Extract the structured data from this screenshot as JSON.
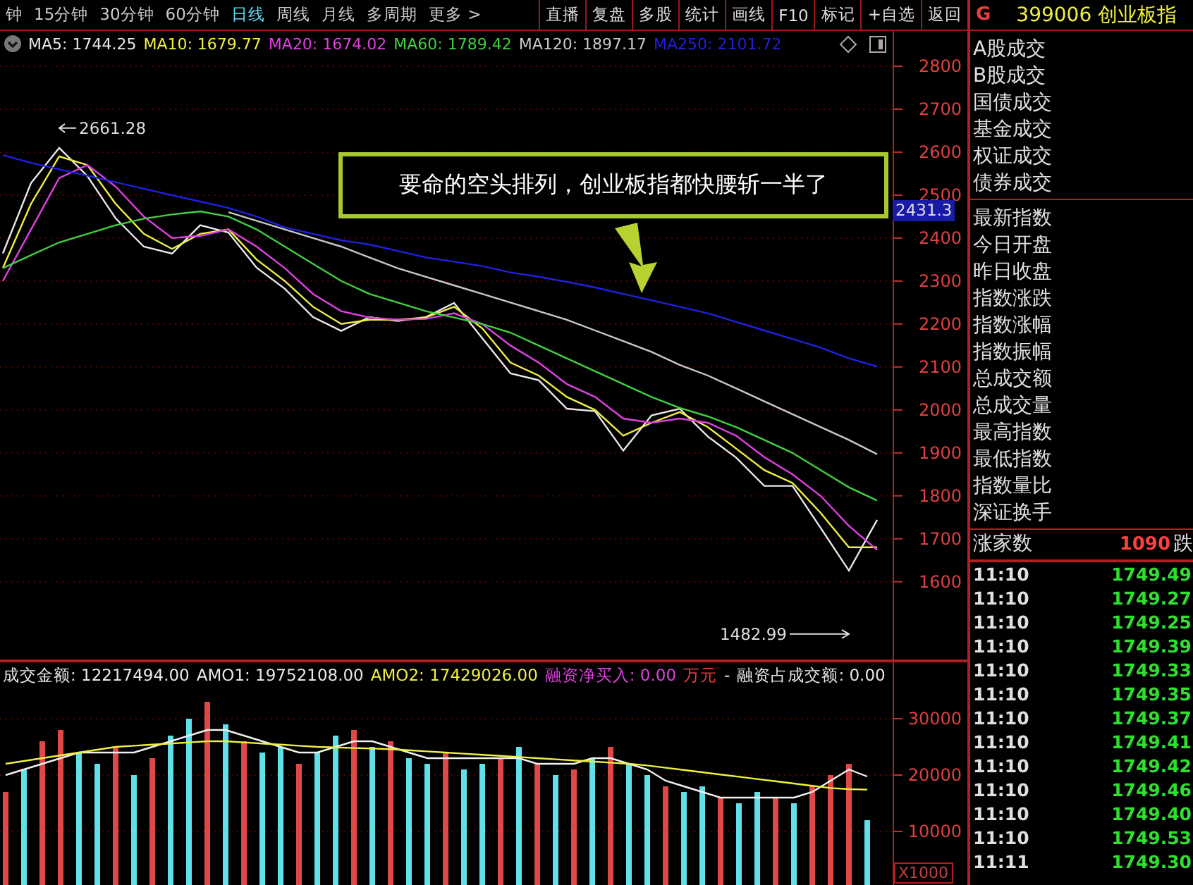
{
  "period_tabs": [
    {
      "label": "钟",
      "selected": false
    },
    {
      "label": "15分钟",
      "selected": false
    },
    {
      "label": "30分钟",
      "selected": false
    },
    {
      "label": "60分钟",
      "selected": false
    },
    {
      "label": "日线",
      "selected": true
    },
    {
      "label": "周线",
      "selected": false
    },
    {
      "label": "月线",
      "selected": false
    },
    {
      "label": "多周期",
      "selected": false
    },
    {
      "label": "更多 >",
      "selected": false
    }
  ],
  "toolbar_buttons": [
    "直播",
    "复盘",
    "多股",
    "统计",
    "画线",
    "F10",
    "标记",
    "+自选",
    "返回"
  ],
  "price_chart": {
    "callout": "要命的空头排列，创业板指都快腰斩一半了",
    "cursor_label": "2431.3",
    "chart_data": {
      "type": "line",
      "grid": true,
      "ylim": [
        1419,
        2882
      ],
      "yticks": [
        1600,
        1700,
        1800,
        1900,
        2000,
        2100,
        2200,
        2300,
        2400,
        2500,
        2600,
        2700,
        2800
      ],
      "series": [
        {
          "name": "MA5: 1744.25",
          "color": "#e8e8e8",
          "values": [
            2364,
            2528,
            2610,
            2544,
            2446,
            2380,
            2364,
            2430,
            2413,
            2331,
            2282,
            2216,
            2184,
            2216,
            2207,
            2216,
            2249,
            2167,
            2085,
            2069,
            2003,
            1997,
            1905,
            1987,
            2003,
            1938,
            1889,
            1823,
            1823,
            1725,
            1626,
            1744
          ]
        },
        {
          "name": "MA10: 1679.77",
          "color": "#f0f040",
          "values": [
            2330,
            2480,
            2590,
            2570,
            2480,
            2410,
            2375,
            2410,
            2420,
            2350,
            2300,
            2240,
            2200,
            2210,
            2210,
            2215,
            2240,
            2190,
            2110,
            2080,
            2030,
            2000,
            1940,
            1970,
            1995,
            1960,
            1910,
            1860,
            1830,
            1760,
            1680,
            1680
          ]
        },
        {
          "name": "MA20: 1674.02",
          "color": "#e040e0",
          "values": [
            2300,
            2420,
            2540,
            2570,
            2520,
            2450,
            2400,
            2405,
            2420,
            2380,
            2330,
            2270,
            2230,
            2215,
            2210,
            2212,
            2225,
            2200,
            2150,
            2110,
            2060,
            2030,
            1980,
            1970,
            1980,
            1970,
            1940,
            1890,
            1850,
            1800,
            1730,
            1674
          ]
        },
        {
          "name": "MA60: 1789.42",
          "color": "#40d040",
          "values": [
            2330,
            2360,
            2390,
            2410,
            2430,
            2445,
            2455,
            2462,
            2450,
            2420,
            2380,
            2340,
            2300,
            2270,
            2250,
            2230,
            2215,
            2200,
            2180,
            2150,
            2120,
            2090,
            2060,
            2030,
            2005,
            1985,
            1960,
            1930,
            1900,
            1860,
            1820,
            1789
          ]
        },
        {
          "name": "MA120: 1897.17",
          "color": "#c8c8c8",
          "values": [
            null,
            null,
            null,
            null,
            null,
            null,
            null,
            null,
            2460,
            2440,
            2420,
            2400,
            2380,
            2355,
            2330,
            2310,
            2290,
            2270,
            2250,
            2230,
            2210,
            2185,
            2160,
            2135,
            2105,
            2080,
            2050,
            2020,
            1990,
            1960,
            1930,
            1897
          ]
        },
        {
          "name": "MA250: 2101.72",
          "color": "#2020e0",
          "values": [
            2593,
            2575,
            2560,
            2545,
            2530,
            2515,
            2500,
            2485,
            2470,
            2450,
            2425,
            2410,
            2395,
            2385,
            2370,
            2355,
            2345,
            2335,
            2320,
            2310,
            2298,
            2285,
            2270,
            2255,
            2240,
            2225,
            2205,
            2185,
            2165,
            2145,
            2120,
            2101
          ]
        }
      ],
      "annotations": [
        "2661.28",
        "1482.99"
      ]
    }
  },
  "volume_header": [
    {
      "text": "成交金额: 12217494.00",
      "color": "#e8e8e8"
    },
    {
      "text": "AMO1: 19752108.00",
      "color": "#e8e8e8"
    },
    {
      "text": "AMO2: 17429026.00",
      "color": "#f0f040"
    },
    {
      "text": "融资净买入: 0.00",
      "color": "#e040e0"
    },
    {
      "text": "万元",
      "color": "#e04040"
    },
    {
      "text": "-",
      "color": "#e8e8e8"
    },
    {
      "text": "融资占成交额: 0.00",
      "color": "#e8e8e8"
    }
  ],
  "volume_chart": {
    "unit": "X1000",
    "chart_data": {
      "type": "bar",
      "grid": true,
      "ylim": [
        500,
        40000
      ],
      "yticks": [
        10000,
        20000,
        30000
      ],
      "series": [
        {
          "color": "#e04848",
          "values": [
            17000,
            null,
            26000,
            28000,
            null,
            null,
            25000,
            null,
            23000,
            null,
            null,
            33000,
            null,
            26000,
            null,
            null,
            22000,
            null,
            null,
            28000,
            null,
            26000,
            null,
            null,
            24000,
            null,
            null,
            23000,
            null,
            22000,
            null,
            21000,
            null,
            25000,
            null,
            null,
            18000,
            null,
            null,
            16000,
            null,
            null,
            16000,
            null,
            18000,
            20000,
            22000,
            null
          ]
        },
        {
          "color": "#60e0e8",
          "values": [
            null,
            21000,
            null,
            null,
            24000,
            22000,
            null,
            20000,
            null,
            27000,
            30000,
            null,
            29000,
            null,
            24000,
            25000,
            null,
            24000,
            27000,
            null,
            25000,
            null,
            23000,
            22000,
            null,
            21000,
            22000,
            null,
            25000,
            null,
            20000,
            null,
            23000,
            null,
            22000,
            20000,
            null,
            17000,
            18000,
            null,
            15000,
            17000,
            null,
            15000,
            null,
            null,
            null,
            12000
          ]
        },
        {
          "type": "line",
          "color": "#f0f0f0",
          "values": [
            20000,
            21000,
            22000,
            23000,
            24000,
            24000,
            24000,
            24000,
            25000,
            26000,
            27000,
            28000,
            28000,
            27000,
            26000,
            25000,
            24000,
            24000,
            25000,
            26000,
            26000,
            25000,
            24000,
            23000,
            23000,
            23000,
            23000,
            23000,
            23000,
            22000,
            22000,
            22000,
            23000,
            23000,
            22000,
            21000,
            19000,
            18000,
            17000,
            16000,
            16000,
            16000,
            16000,
            16000,
            17000,
            19000,
            21000,
            19750
          ]
        },
        {
          "type": "line",
          "color": "#f0f040",
          "values": [
            22000,
            22500,
            23000,
            23500,
            24000,
            24500,
            25000,
            25200,
            25400,
            25600,
            25800,
            26000,
            26000,
            25800,
            25600,
            25400,
            25200,
            25000,
            24900,
            24800,
            24700,
            24600,
            24400,
            24200,
            24000,
            23800,
            23600,
            23400,
            23200,
            23000,
            22800,
            22600,
            22400,
            22200,
            22000,
            21700,
            21300,
            20900,
            20500,
            20100,
            19700,
            19300,
            18900,
            18500,
            18100,
            17700,
            17500,
            17430
          ]
        }
      ]
    }
  },
  "quote_header": {
    "market": "G",
    "code": "399006",
    "name": "创业板指"
  },
  "trade_labels": [
    "A股成交",
    "B股成交",
    "国债成交",
    "基金成交",
    "权证成交",
    "债券成交"
  ],
  "index_labels": [
    "最新指数",
    "今日开盘",
    "昨日收盘",
    "指数涨跌",
    "指数涨幅",
    "指数振幅",
    "总成交额",
    "总成交量",
    "最高指数",
    "最低指数",
    "指数量比",
    "深证换手"
  ],
  "breadth": {
    "label": "涨家数",
    "up_count": "1090",
    "down_label": "跌"
  },
  "ticks": [
    {
      "time": "11:10",
      "price": "1749.49"
    },
    {
      "time": "11:10",
      "price": "1749.27"
    },
    {
      "time": "11:10",
      "price": "1749.25"
    },
    {
      "time": "11:10",
      "price": "1749.39"
    },
    {
      "time": "11:10",
      "price": "1749.33"
    },
    {
      "time": "11:10",
      "price": "1749.35"
    },
    {
      "time": "11:10",
      "price": "1749.37"
    },
    {
      "time": "11:10",
      "price": "1749.41"
    },
    {
      "time": "11:10",
      "price": "1749.42"
    },
    {
      "time": "11:10",
      "price": "1749.46"
    },
    {
      "time": "11:10",
      "price": "1749.40"
    },
    {
      "time": "11:10",
      "price": "1749.53"
    },
    {
      "time": "11:11",
      "price": "1749.30"
    }
  ]
}
